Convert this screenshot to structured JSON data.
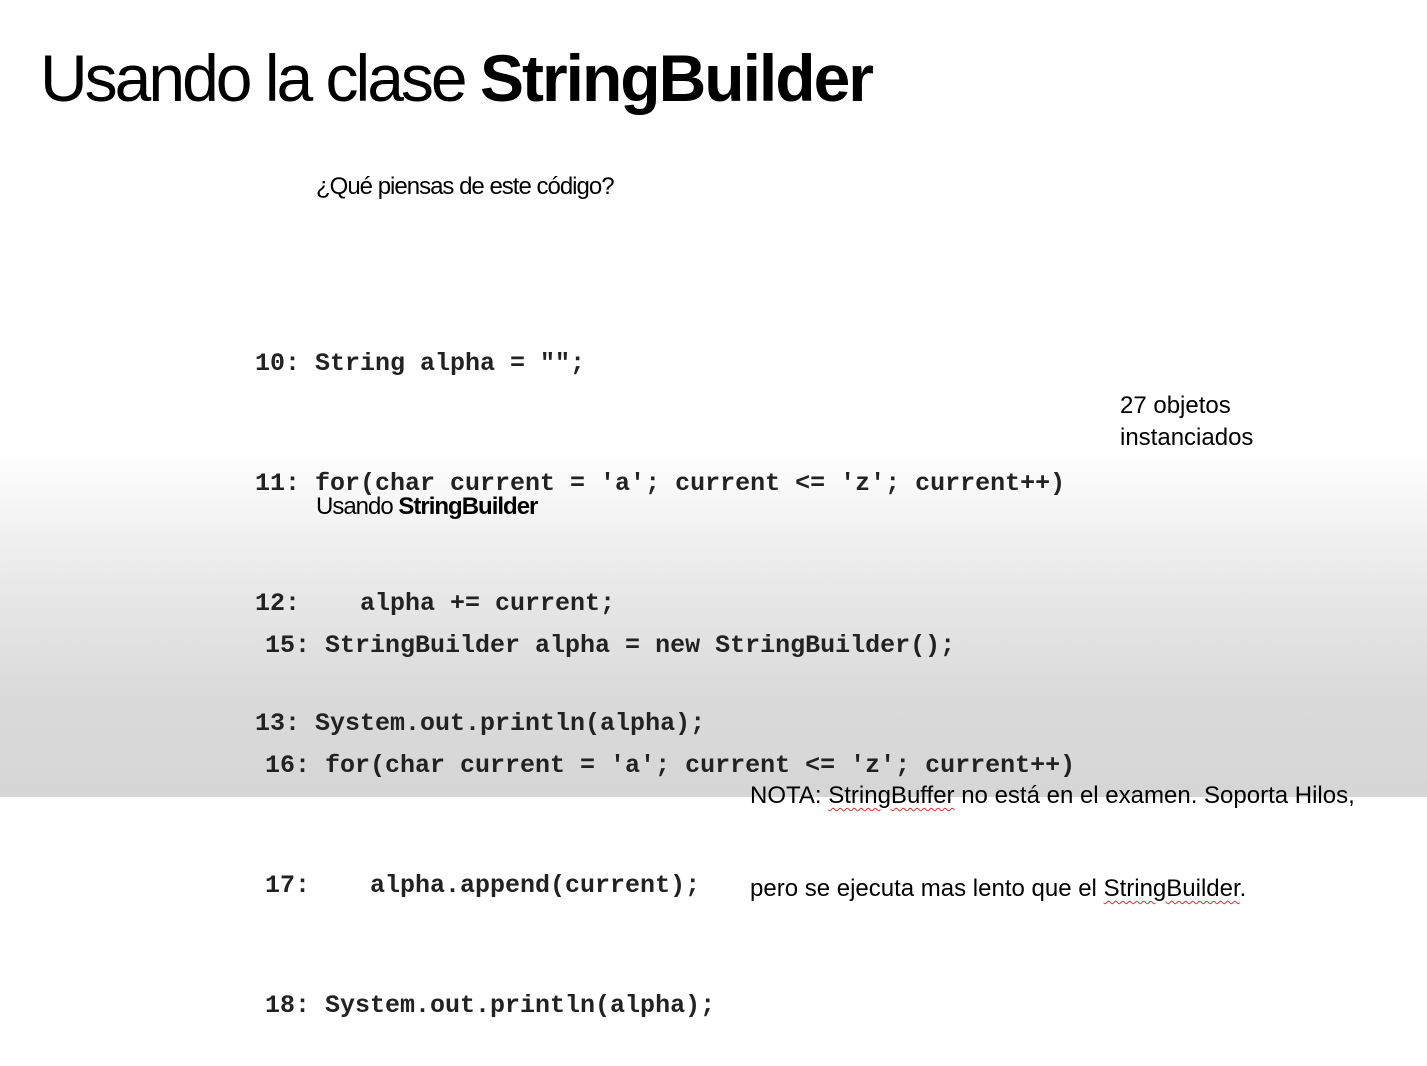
{
  "title": {
    "regular": "Usando la clase ",
    "bold": "StringBuilder"
  },
  "question": "¿Qué piensas de este código?",
  "code_block_1": [
    "10: String alpha = \"\";",
    "11: for(char current = 'a'; current <= 'z'; current++)",
    "12:    alpha += current;",
    "13: System.out.println(alpha);"
  ],
  "objects_note": {
    "line1": "27 objetos",
    "line2": "instanciados"
  },
  "subheading": {
    "regular": "Usando ",
    "bold": "StringBuilder"
  },
  "code_block_2": [
    "15: StringBuilder alpha = new StringBuilder();",
    "16: for(char current = 'a'; current <= 'z'; current++)",
    "17:    alpha.append(current);",
    "18: System.out.println(alpha);"
  ],
  "note": {
    "l1_a": "NOTA: ",
    "l1_b": "StringBuffer",
    "l1_c": " no está en el examen. Soporta Hilos,",
    "l2_a": "pero se ejecuta mas lento que el ",
    "l2_b": "StringBuilder",
    "l2_c": "."
  }
}
